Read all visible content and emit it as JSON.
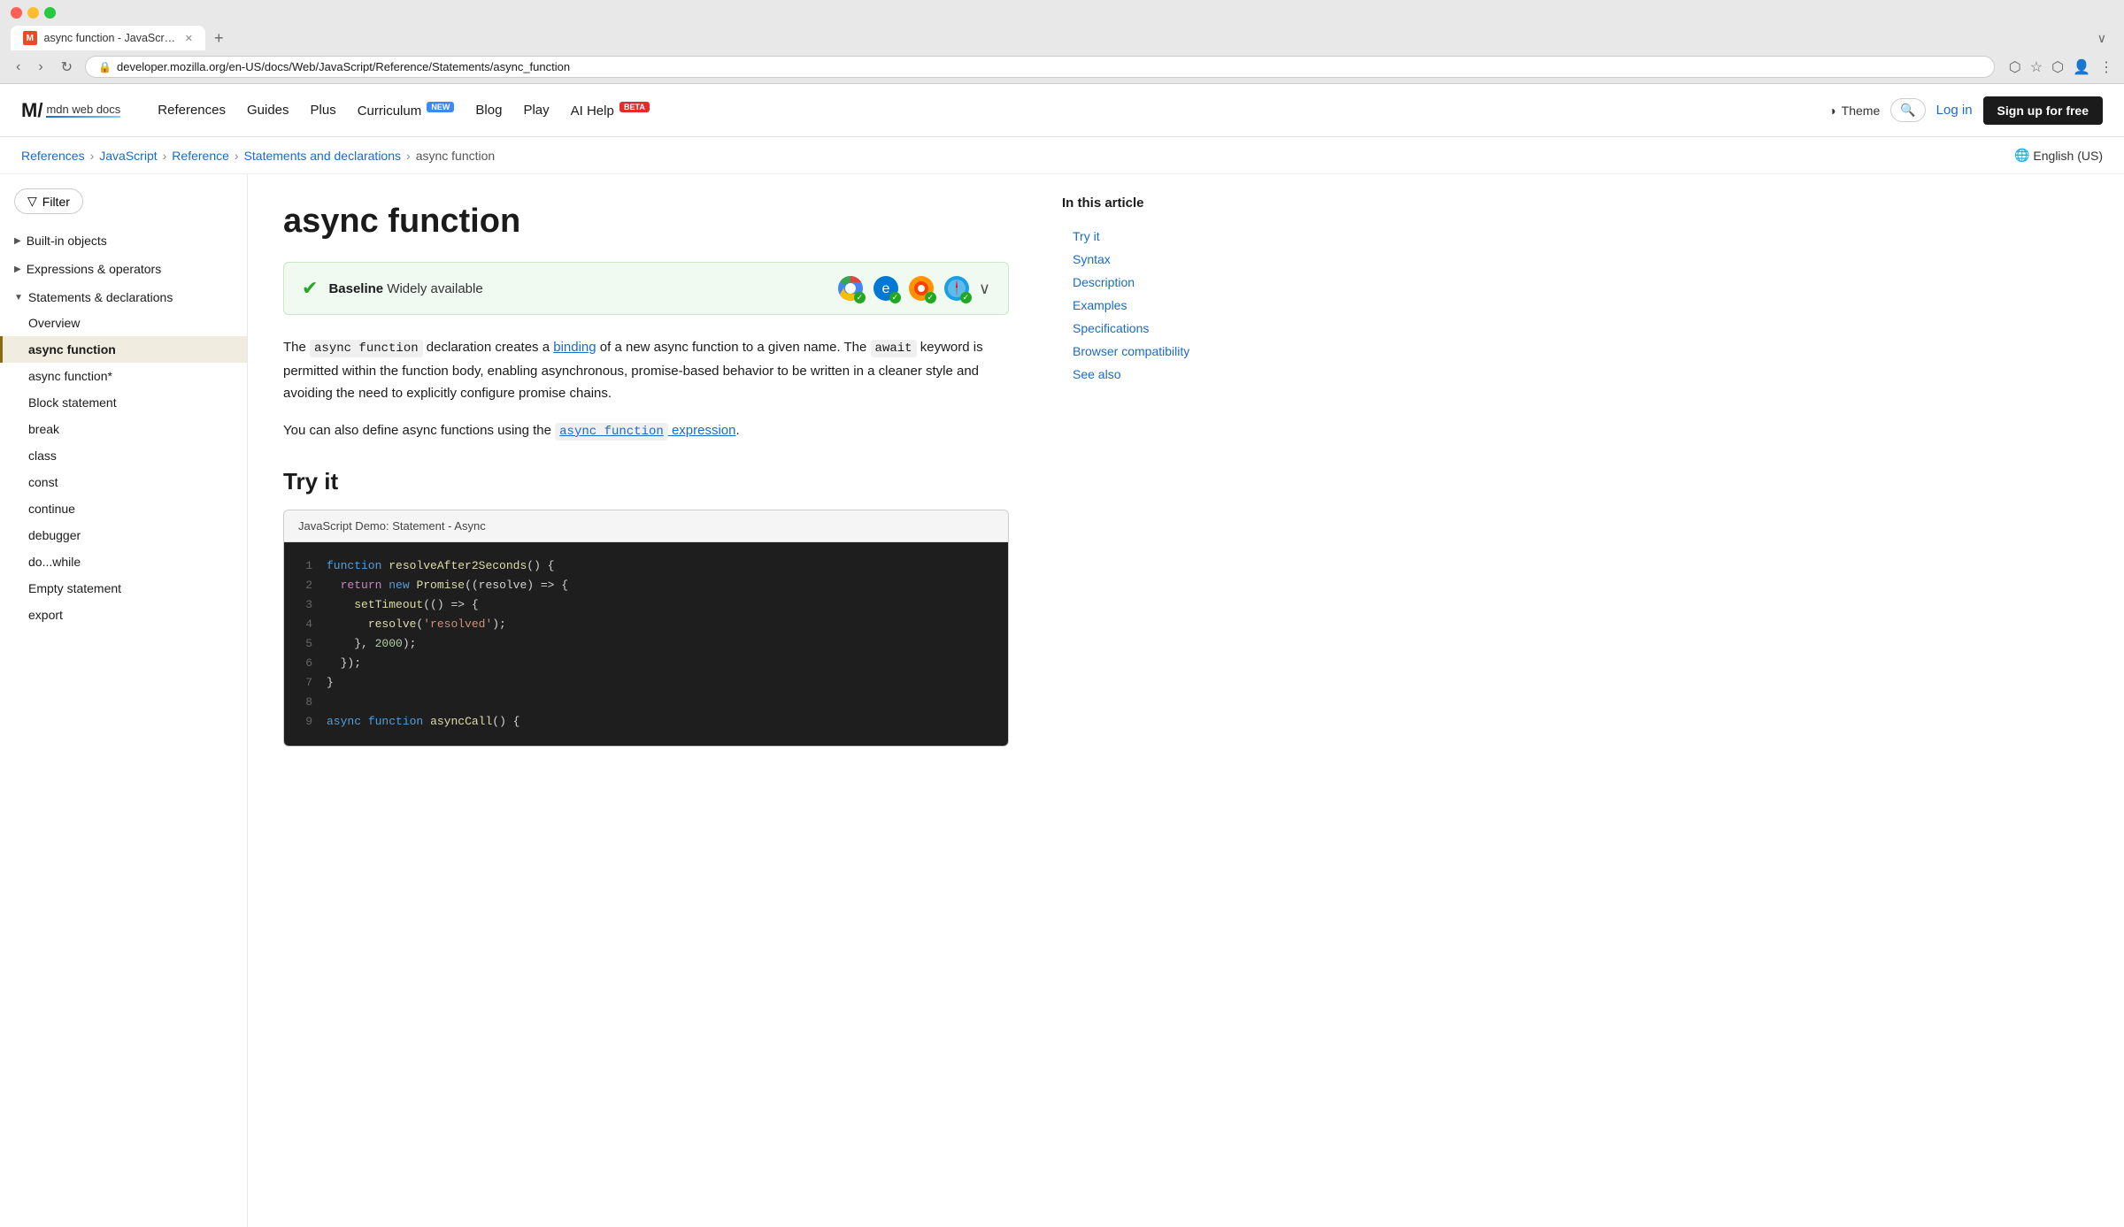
{
  "browser": {
    "tab_title": "async function - JavaScript |",
    "url": "developer.mozilla.org/en-US/docs/Web/JavaScript/Reference/Statements/async_function",
    "new_tab_label": "+"
  },
  "header": {
    "logo_mark": "M/",
    "logo_text": "mdn web docs",
    "nav_items": [
      {
        "label": "References",
        "badge": null
      },
      {
        "label": "Guides",
        "badge": null
      },
      {
        "label": "Plus",
        "badge": null
      },
      {
        "label": "Curriculum",
        "badge": "NEW"
      },
      {
        "label": "Blog",
        "badge": null
      },
      {
        "label": "Play",
        "badge": null
      },
      {
        "label": "AI Help",
        "badge": "BETA"
      }
    ],
    "theme_label": "Theme",
    "login_label": "Log in",
    "signup_label": "Sign up for free"
  },
  "breadcrumb": {
    "items": [
      {
        "label": "References",
        "href": "#"
      },
      {
        "label": "JavaScript",
        "href": "#"
      },
      {
        "label": "Reference",
        "href": "#"
      },
      {
        "label": "Statements and declarations",
        "href": "#"
      },
      {
        "label": "async function",
        "href": null
      }
    ],
    "lang": "English (US)"
  },
  "sidebar": {
    "filter_label": "Filter",
    "sections": [
      {
        "label": "Built-in objects",
        "expanded": false,
        "items": []
      },
      {
        "label": "Expressions & operators",
        "expanded": false,
        "items": []
      },
      {
        "label": "Statements & declarations",
        "expanded": true,
        "items": [
          {
            "label": "Overview",
            "active": false
          },
          {
            "label": "async function",
            "active": true
          },
          {
            "label": "async function*",
            "active": false
          },
          {
            "label": "Block statement",
            "active": false
          },
          {
            "label": "break",
            "active": false
          },
          {
            "label": "class",
            "active": false
          },
          {
            "label": "const",
            "active": false
          },
          {
            "label": "continue",
            "active": false
          },
          {
            "label": "debugger",
            "active": false
          },
          {
            "label": "do...while",
            "active": false
          },
          {
            "label": "Empty statement",
            "active": false
          },
          {
            "label": "export",
            "active": false
          }
        ]
      }
    ]
  },
  "article": {
    "title": "async function",
    "baseline": {
      "check": "✔",
      "label": "Baseline",
      "desc": "Widely available",
      "browsers": [
        {
          "name": "Chrome",
          "symbol": "🌐"
        },
        {
          "name": "Edge",
          "symbol": "🌀"
        },
        {
          "name": "Firefox",
          "symbol": "🦊"
        },
        {
          "name": "Safari",
          "symbol": "🧭"
        }
      ]
    },
    "intro1": "The async function declaration creates a binding of a new async function to a given name. The await keyword is permitted within the function body, enabling asynchronous, promise-based behavior to be written in a cleaner style and avoiding the need to explicitly configure promise chains.",
    "intro_link1": "binding",
    "intro2": "You can also define async functions using the",
    "intro_link2": "async function expression",
    "try_it_title": "Try it",
    "code_demo_header": "JavaScript Demo: Statement - Async",
    "code_lines": [
      {
        "num": 1,
        "code": "function resolveAfter2Seconds() {"
      },
      {
        "num": 2,
        "code": "  return new Promise((resolve) => {"
      },
      {
        "num": 3,
        "code": "    setTimeout(() => {"
      },
      {
        "num": 4,
        "code": "      resolve('resolved');"
      },
      {
        "num": 5,
        "code": "    }, 2000);"
      },
      {
        "num": 6,
        "code": "  });"
      },
      {
        "num": 7,
        "code": "}"
      },
      {
        "num": 8,
        "code": ""
      },
      {
        "num": 9,
        "code": "async function asyncCall() {"
      }
    ]
  },
  "toc": {
    "title": "In this article",
    "items": [
      {
        "label": "Try it"
      },
      {
        "label": "Syntax"
      },
      {
        "label": "Description"
      },
      {
        "label": "Examples"
      },
      {
        "label": "Specifications"
      },
      {
        "label": "Browser compatibility"
      },
      {
        "label": "See also"
      }
    ]
  }
}
